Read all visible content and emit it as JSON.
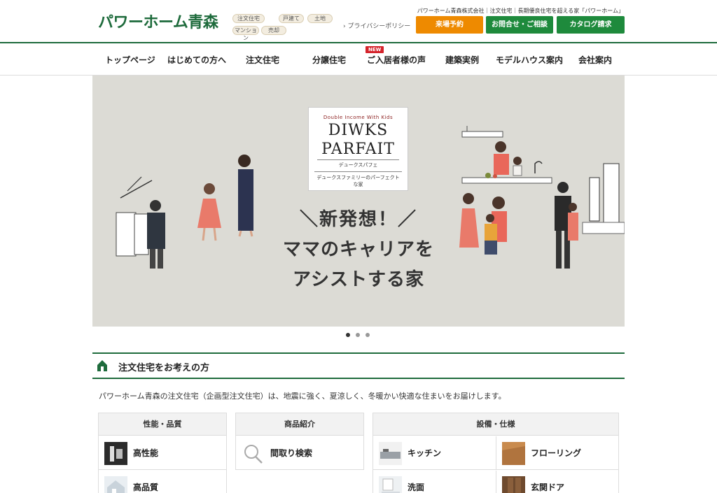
{
  "header": {
    "logo": "パワーホーム青森",
    "tags": [
      "注文住宅",
      "戸建て",
      "土地",
      "マンション",
      "売却"
    ],
    "company_line": "パワーホーム青森株式会社｜注文住宅｜長期優良住宅を超える家「パワーホーム」",
    "privacy": "› プライバシーポリシー",
    "buttons": {
      "visit": "来場予約",
      "contact": "お問合せ・ご相談",
      "catalog": "カタログ請求"
    }
  },
  "nav": {
    "items": [
      "トップページ",
      "はじめての方へ",
      "注文住宅",
      "分譲住宅",
      "ご入居者様の声",
      "建築実例",
      "モデルハウス案内",
      "会社案内"
    ],
    "new_badge": "NEW"
  },
  "hero": {
    "card_small": "Double Income With Kids",
    "card_line1": "DIWKS",
    "card_line2": "PARFAIT",
    "card_kana": "デュークスパフェ",
    "card_desc": "デュークスファミリーのパーフェクトな家",
    "copy_l1": "＼新発想！／",
    "copy_l2": "ママのキャリアを",
    "copy_l3": "アシストする家"
  },
  "slider": {
    "count": 3,
    "active": 1
  },
  "section": {
    "title": "注文住宅をお考えの方",
    "intro": "パワーホーム青森の注文住宅（企画型注文住宅）は、地震に強く、夏涼しく、冬暖かい快適な住まいをお届けします。"
  },
  "panels": {
    "performance": {
      "title": "性能・品質",
      "items": [
        "高性能",
        "高品質"
      ]
    },
    "products": {
      "title": "商品紹介",
      "items": [
        "間取り検索"
      ]
    },
    "equipment": {
      "title": "設備・仕様",
      "items": [
        "キッチン",
        "フローリング",
        "洗面",
        "玄関ドア"
      ]
    }
  },
  "colors": {
    "brand_green": "#1e6b3c",
    "button_green": "#1e8a3c",
    "button_orange": "#ee8a00",
    "badge_red": "#d4232b"
  }
}
